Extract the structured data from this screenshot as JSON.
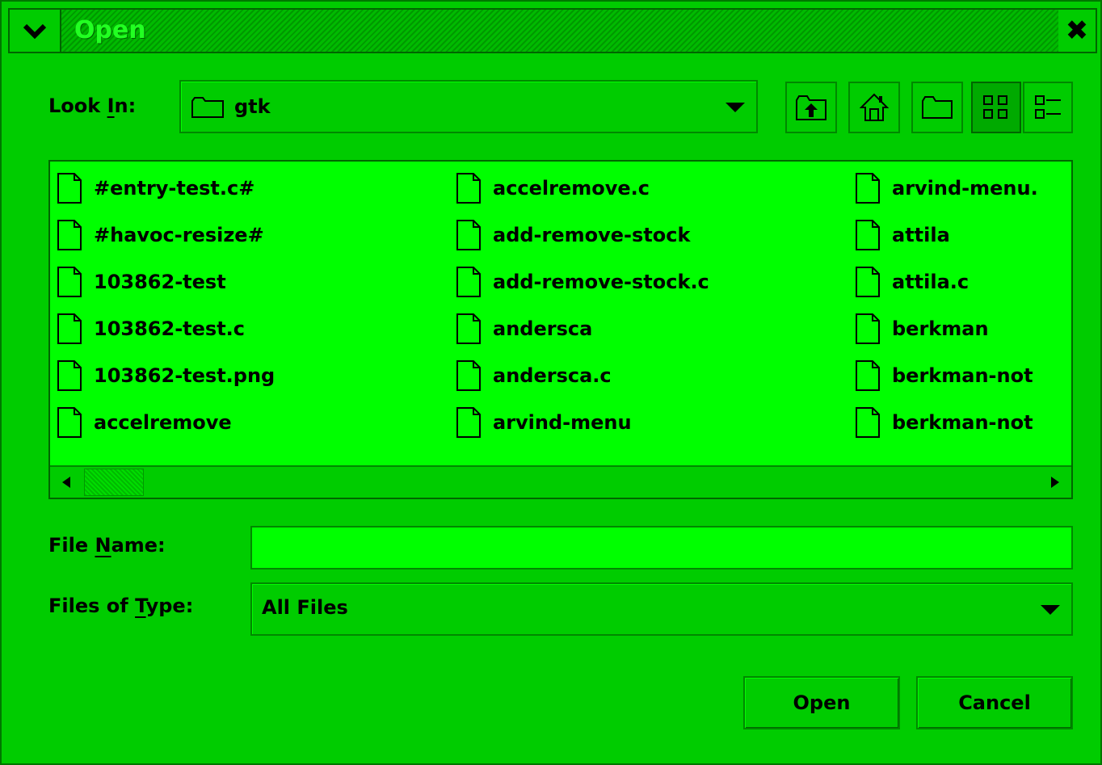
{
  "window": {
    "title": "Open",
    "close_glyph": "✖"
  },
  "look_in": {
    "label_pre": "Look ",
    "label_key": "I",
    "label_post": "n:",
    "value": "gtk"
  },
  "toolbar": [
    {
      "name": "up-folder-icon"
    },
    {
      "name": "home-icon"
    },
    {
      "name": "new-folder-icon"
    },
    {
      "name": "list-view-icon",
      "active": true
    },
    {
      "name": "details-view-icon"
    }
  ],
  "files": {
    "col1": [
      "#entry-test.c#",
      "#havoc-resize#",
      "103862-test",
      "103862-test.c",
      "103862-test.png",
      "accelremove"
    ],
    "col2": [
      "accelremove.c",
      "add-remove-stock",
      "add-remove-stock.c",
      "andersca",
      "andersca.c",
      "arvind-menu"
    ],
    "col3": [
      "arvind-menu.",
      "attila",
      "attila.c",
      "berkman",
      "berkman-not",
      "berkman-not"
    ]
  },
  "file_name": {
    "label_pre": "File ",
    "label_key": "N",
    "label_post": "ame:",
    "value": ""
  },
  "file_type": {
    "label_pre": "Files of ",
    "label_key": "T",
    "label_post": "ype:",
    "value": "All Files"
  },
  "buttons": {
    "open": "Open",
    "cancel": "Cancel"
  },
  "colors": {
    "background": "#00cc00",
    "list_background": "#00ff00",
    "title_text": "#22ff22"
  }
}
